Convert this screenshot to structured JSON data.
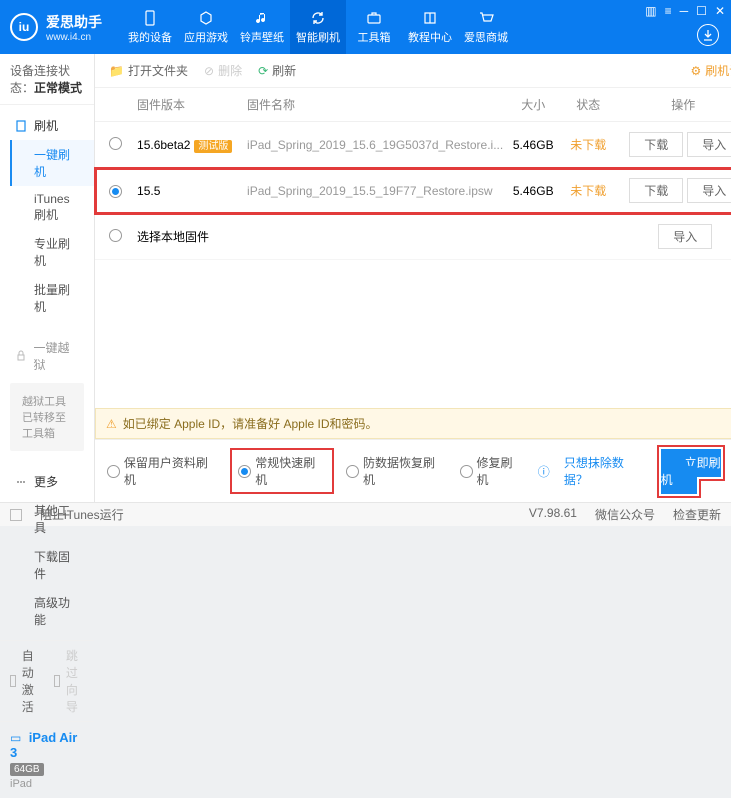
{
  "brand": {
    "name": "爱思助手",
    "url": "www.i4.cn",
    "logo": "iu"
  },
  "nav": [
    {
      "label": "我的设备"
    },
    {
      "label": "应用游戏"
    },
    {
      "label": "铃声壁纸"
    },
    {
      "label": "智能刷机",
      "active": true
    },
    {
      "label": "工具箱"
    },
    {
      "label": "教程中心"
    },
    {
      "label": "爱思商城"
    }
  ],
  "conn": {
    "label": "设备连接状态：",
    "value": "正常模式"
  },
  "sidebar": {
    "flash": {
      "header": "刷机",
      "items": [
        "一键刷机",
        "iTunes刷机",
        "专业刷机",
        "批量刷机"
      ],
      "activeIndex": 0
    },
    "jailbreak": {
      "header": "一键越狱",
      "note": "越狱工具已转移至工具箱"
    },
    "more": {
      "header": "更多",
      "items": [
        "其他工具",
        "下载固件",
        "高级功能"
      ]
    },
    "autoActivate": "自动激活",
    "skipGuide": "跳过向导"
  },
  "device": {
    "name": "iPad Air 3",
    "storage": "64GB",
    "type": "iPad"
  },
  "toolbar": {
    "open": "打开文件夹",
    "delete": "删除",
    "refresh": "刷新",
    "settings": "刷机设置"
  },
  "table": {
    "head": {
      "ver": "固件版本",
      "name": "固件名称",
      "size": "大小",
      "status": "状态",
      "ops": "操作"
    },
    "rows": [
      {
        "ver": "15.6beta2",
        "beta": "测试版",
        "name": "iPad_Spring_2019_15.6_19G5037d_Restore.i...",
        "size": "5.46GB",
        "status": "未下载",
        "dl": "下载",
        "imp": "导入",
        "selected": false
      },
      {
        "ver": "15.5",
        "name": "iPad_Spring_2019_15.5_19F77_Restore.ipsw",
        "size": "5.46GB",
        "status": "未下载",
        "dl": "下载",
        "imp": "导入",
        "selected": true,
        "highlight": true
      }
    ],
    "localRow": {
      "label": "选择本地固件",
      "imp": "导入"
    }
  },
  "warning": {
    "text": "如已绑定 Apple ID，请准备好 Apple ID和密码。"
  },
  "flashOpts": {
    "opts": [
      "保留用户资料刷机",
      "常规快速刷机",
      "防数据恢复刷机",
      "修复刷机"
    ],
    "selectedIndex": 1,
    "help": "只想抹除数据？",
    "action": "立即刷机"
  },
  "statusbar": {
    "blockItunes": "阻止iTunes运行",
    "version": "V7.98.61",
    "wechat": "微信公众号",
    "check": "检查更新"
  }
}
